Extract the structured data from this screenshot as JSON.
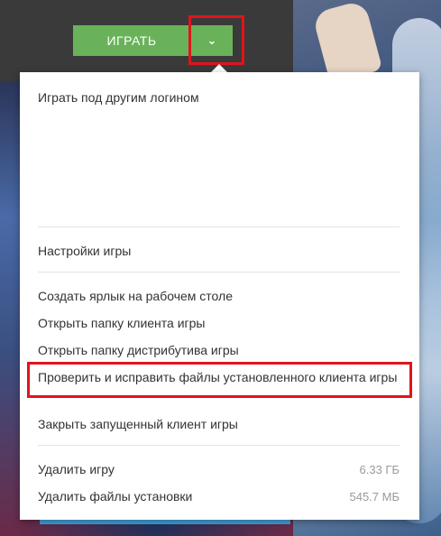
{
  "play_button": {
    "label": "ИГРАТЬ"
  },
  "dropdown_button": {
    "icon": "chevron-down-icon"
  },
  "menu": {
    "login_other": "Играть под другим логином",
    "game_settings": "Настройки игры",
    "create_shortcut": "Создать ярлык на рабочем столе",
    "open_client_folder": "Открыть папку клиента игры",
    "open_distrib_folder": "Открыть папку дистрибутива игры",
    "verify_repair": "Проверить и исправить файлы установленного клиента игры",
    "close_client": "Закрыть запущенный клиент игры",
    "delete_game": "Удалить игру",
    "delete_game_size": "6.33 ГБ",
    "delete_install_files": "Удалить файлы установки",
    "delete_install_size": "545.7 МБ"
  },
  "colors": {
    "play_green": "#6ab25a",
    "highlight_red": "#e0141c",
    "topbar": "#3a3a3a"
  }
}
